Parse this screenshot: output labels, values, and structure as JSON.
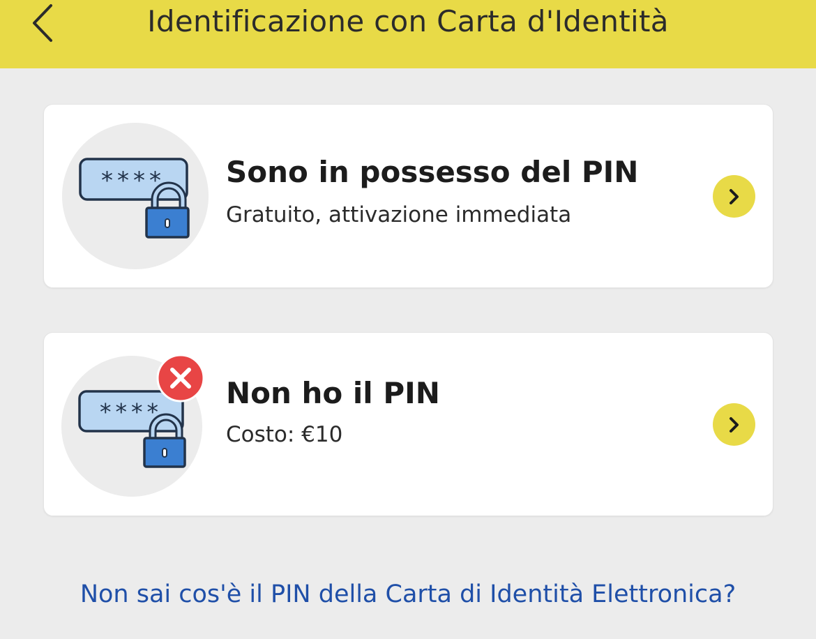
{
  "header": {
    "title": "Identificazione con Carta d'Identità",
    "back_icon": "chevron-left-icon",
    "background": "#e8da47"
  },
  "options": [
    {
      "title": "Sono in possesso del PIN",
      "subtitle": "Gratuito, attivazione immediata",
      "illustration": "pin-lock-icon",
      "action_icon": "chevron-right-icon"
    },
    {
      "title": "Non ho il PIN",
      "subtitle": "Costo: €10",
      "illustration": "pin-lock-error-icon",
      "action_icon": "chevron-right-icon"
    }
  ],
  "help_link": "Non sai cos'è il PIN della Carta di Identità Elettronica?",
  "colors": {
    "accent_yellow": "#e8da47",
    "link_blue": "#1f4fa8",
    "error_red": "#e84545",
    "lock_blue": "#3b7fd1"
  }
}
